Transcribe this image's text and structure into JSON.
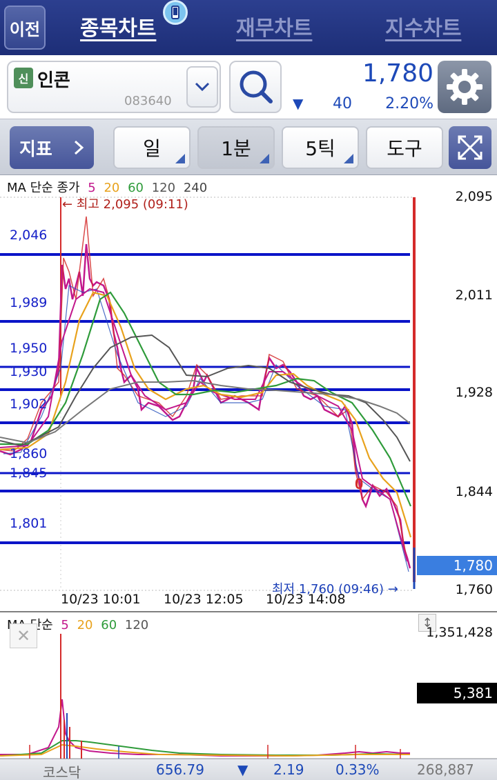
{
  "nav": {
    "back_label": "이전",
    "tabs": [
      {
        "label": "종목차트",
        "active": true
      },
      {
        "label": "재무차트",
        "active": false
      },
      {
        "label": "지수차트",
        "active": false
      }
    ],
    "badge_icon": "phone-icon"
  },
  "stock": {
    "market_badge": "신",
    "name": "인콘",
    "code": "083640",
    "price": "1,780",
    "direction": "▼",
    "change": "40",
    "change_pct": "2.20%"
  },
  "toolbar": {
    "indicator_label": "지표",
    "buttons": [
      "일",
      "1분",
      "5틱",
      "도구"
    ]
  },
  "price_chart": {
    "legend": {
      "prefix": "MA 단순 종가",
      "periods": [
        "5",
        "20",
        "60",
        "120",
        "240"
      ]
    },
    "y_axis_labels": [
      "2,095",
      "2,011",
      "1,928",
      "1,844",
      "1,780",
      "1,760"
    ],
    "hline_labels": [
      "2,046",
      "1,989",
      "1,950",
      "1,930",
      "1,902",
      "1,860",
      "1,845",
      "1,801"
    ],
    "x_axis_labels": [
      "10/23 10:01",
      "10/23 12:05",
      "10/23 14:08"
    ],
    "high_note": "← 최고 2,095 (09:11)",
    "low_note": "최저 1,760 (09:46) →",
    "marker": "0"
  },
  "volume_chart": {
    "legend": {
      "prefix": "MA 단순",
      "periods": [
        "5",
        "20",
        "60",
        "120"
      ]
    },
    "top_label": "1,351,428",
    "current_volume": "5,381"
  },
  "index_bar": {
    "name": "코스닥",
    "value": "656.79",
    "direction": "▼",
    "change": "2.19",
    "pct": "0.33%",
    "volume": "268,887"
  },
  "colors": {
    "ma5": "#c2188c",
    "ma20": "#e8a21c",
    "ma60": "#2e9b3a",
    "ma120": "#555555",
    "ma240": "#777777",
    "support_line": "#0a14c8",
    "down": "#1d49b8",
    "up": "#d42a2a"
  }
}
